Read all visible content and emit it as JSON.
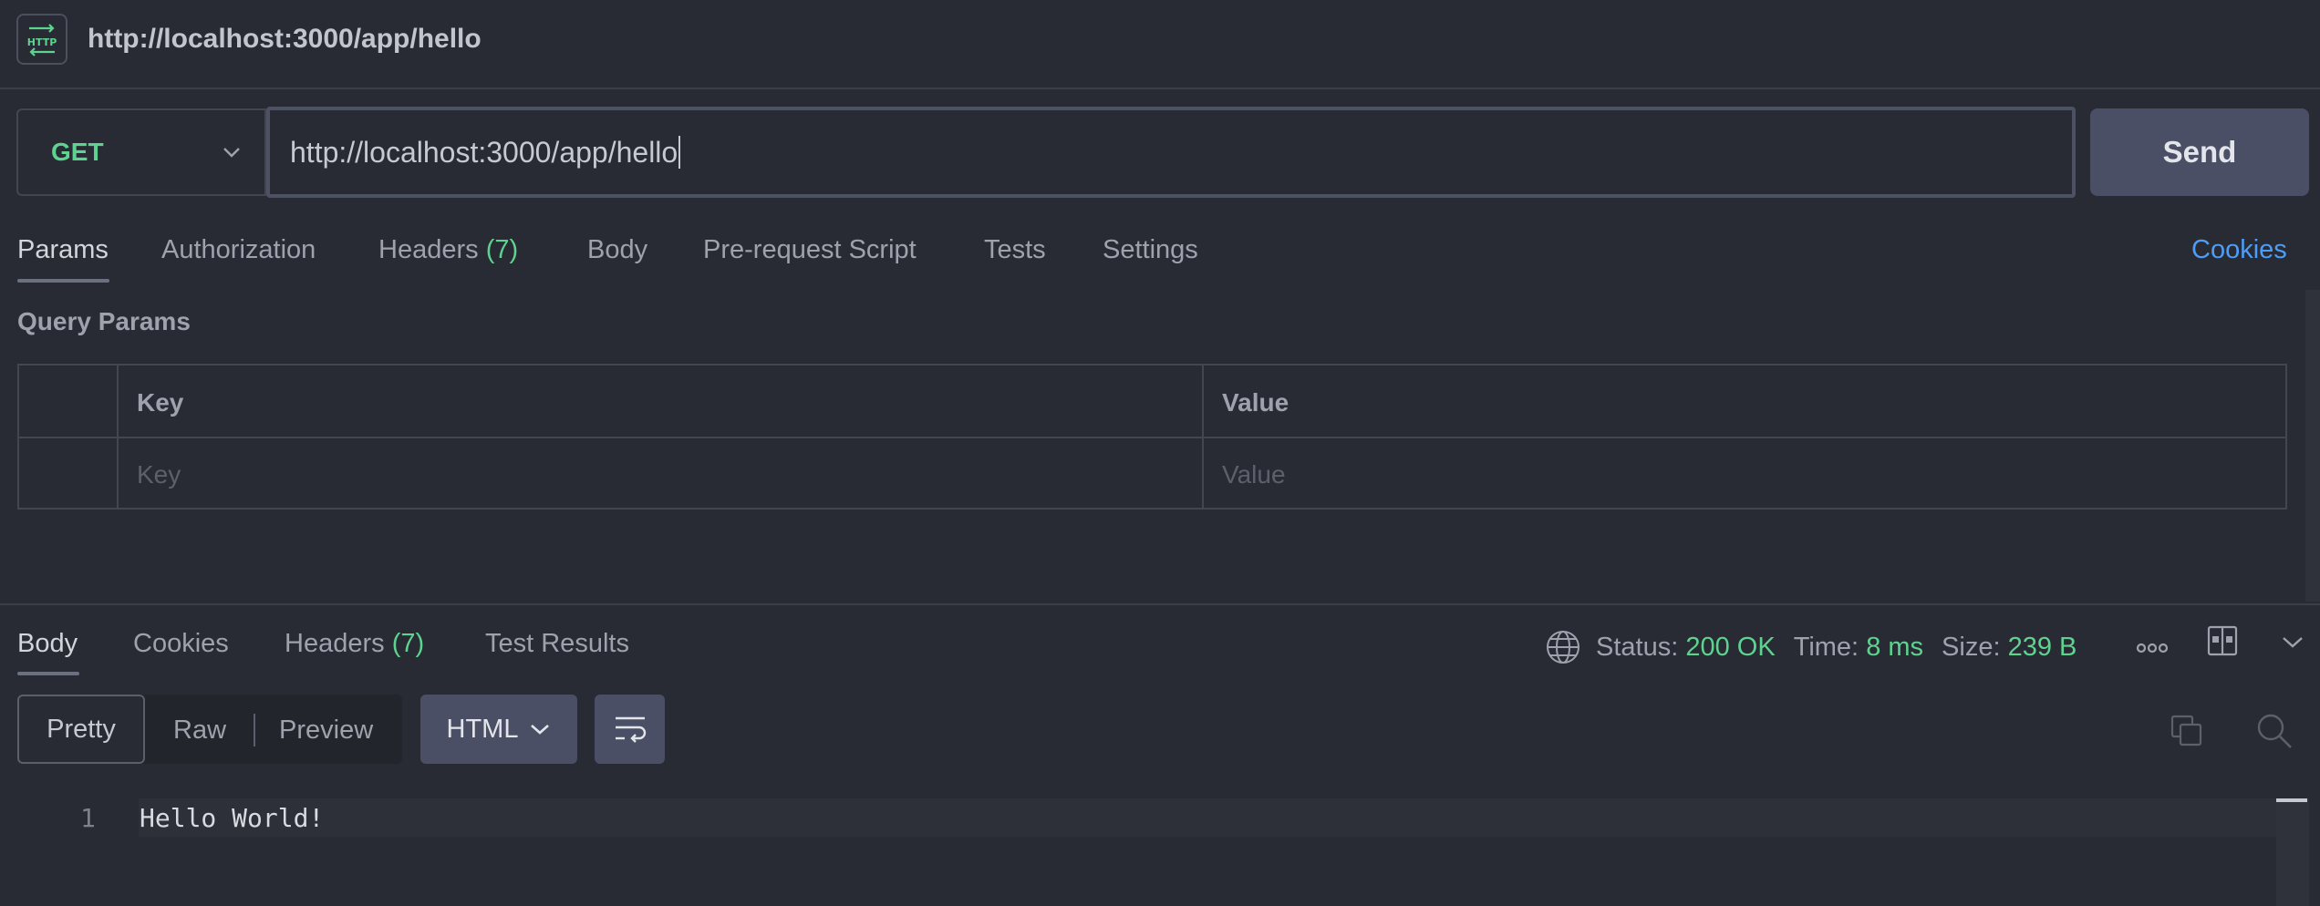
{
  "window": {
    "title": "http://localhost:3000/app/hello"
  },
  "request": {
    "method": "GET",
    "url": "http://localhost:3000/app/hello",
    "send_label": "Send"
  },
  "request_tabs": [
    {
      "label": "Params"
    },
    {
      "label": "Authorization"
    },
    {
      "label": "Headers",
      "count": "(7)"
    },
    {
      "label": "Body"
    },
    {
      "label": "Pre-request Script"
    },
    {
      "label": "Tests"
    },
    {
      "label": "Settings"
    }
  ],
  "cookies_link": "Cookies",
  "params": {
    "section_title": "Query Params",
    "columns": [
      "Key",
      "Value"
    ],
    "placeholders": {
      "key": "Key",
      "value": "Value"
    }
  },
  "response_tabs": [
    {
      "label": "Body"
    },
    {
      "label": "Cookies"
    },
    {
      "label": "Headers",
      "count": "(7)"
    },
    {
      "label": "Test Results"
    }
  ],
  "status": {
    "status_label": "Status:",
    "status_value": "200 OK",
    "time_label": "Time:",
    "time_value": "8 ms",
    "size_label": "Size:",
    "size_value": "239 B"
  },
  "format": {
    "pretty": "Pretty",
    "raw": "Raw",
    "preview": "Preview",
    "language": "HTML"
  },
  "response_body": {
    "lines": [
      {
        "number": "1",
        "text": "Hello World!"
      }
    ]
  },
  "colors": {
    "accent_green": "#5dd38f",
    "link_blue": "#4d9df7",
    "button_bg": "#4a4f66",
    "background": "#282b33"
  }
}
